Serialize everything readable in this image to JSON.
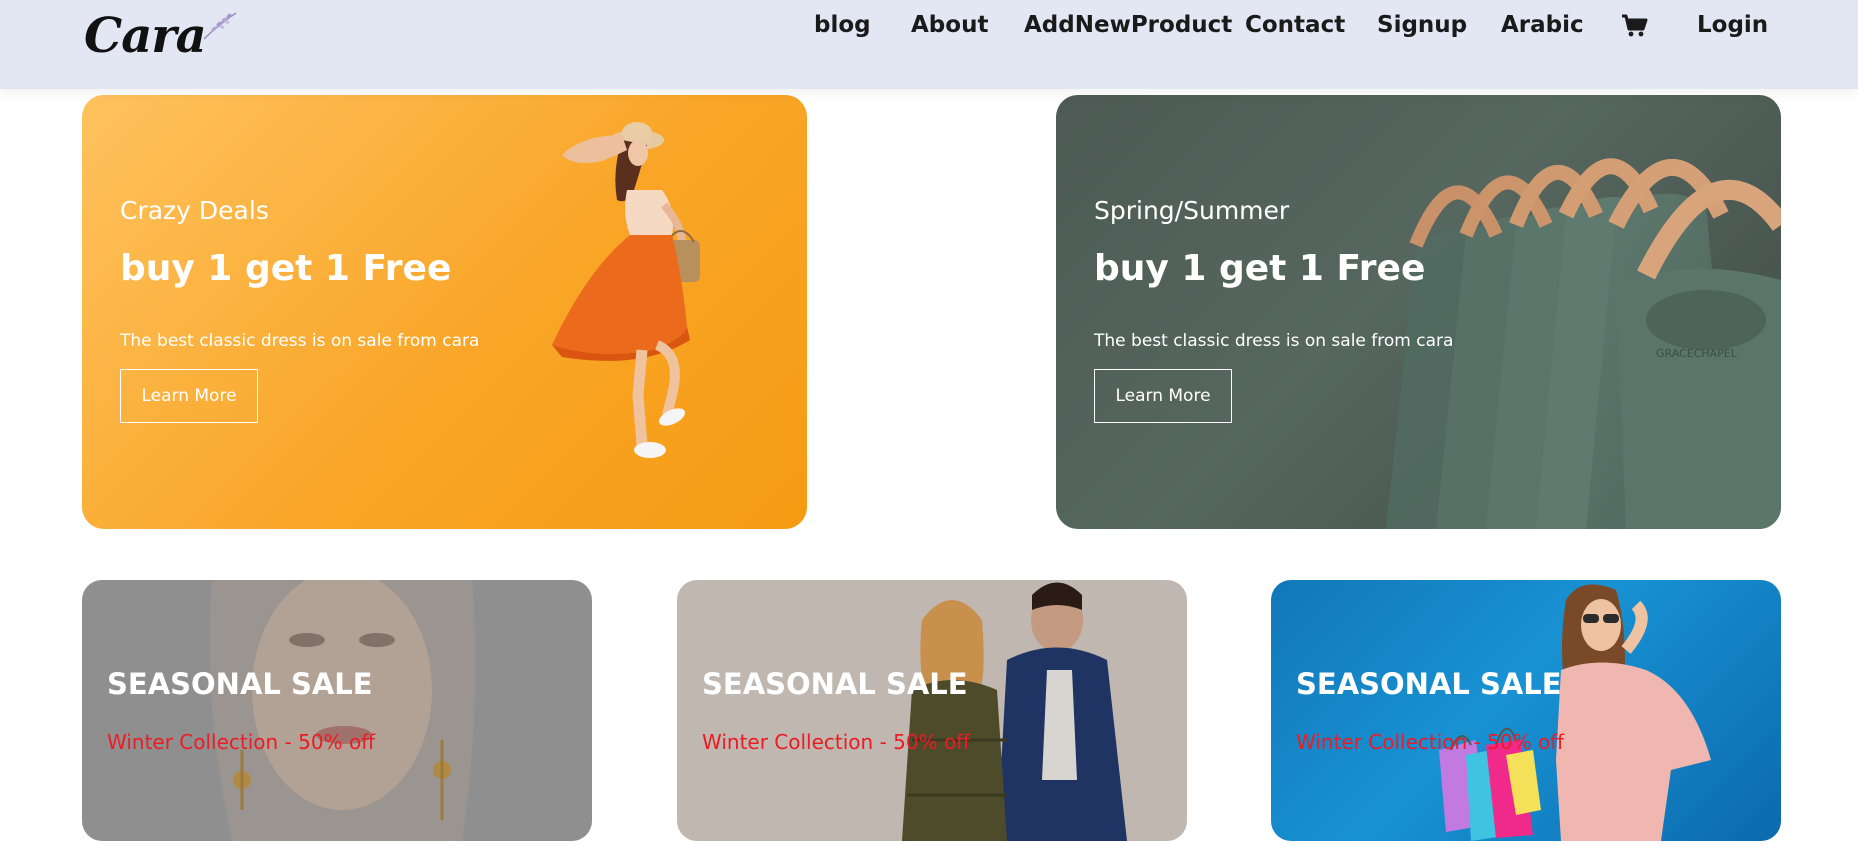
{
  "header": {
    "logo_text": "Cara",
    "nav": {
      "blog": "blog",
      "about": "About",
      "add_product": "AddNewProduct",
      "contact": "Contact",
      "signup": "Signup",
      "arabic": "Arabic",
      "cart_icon": "cart-icon",
      "login": "Login"
    }
  },
  "banners": [
    {
      "subtitle": "Crazy Deals",
      "title": "buy 1 get 1 Free",
      "description": "The best classic dress is on sale from cara",
      "button_label": "Learn More"
    },
    {
      "subtitle": "Spring/Summer",
      "title": "buy 1 get 1 Free",
      "description": "The best classic dress is on sale from cara",
      "button_label": "Learn More"
    }
  ],
  "small_banners": [
    {
      "title": "SEASONAL SALE",
      "subtitle": "Winter Collection - 50% off"
    },
    {
      "title": "SEASONAL SALE",
      "subtitle": "Winter Collection - 50% off"
    },
    {
      "title": "SEASONAL SALE",
      "subtitle": "Winter Collection - 50% off"
    }
  ],
  "colors": {
    "header_bg": "#e3e6f3",
    "accent_red": "#ec1c24",
    "banner_orange": "#f9a628",
    "banner_green": "#56675f"
  }
}
